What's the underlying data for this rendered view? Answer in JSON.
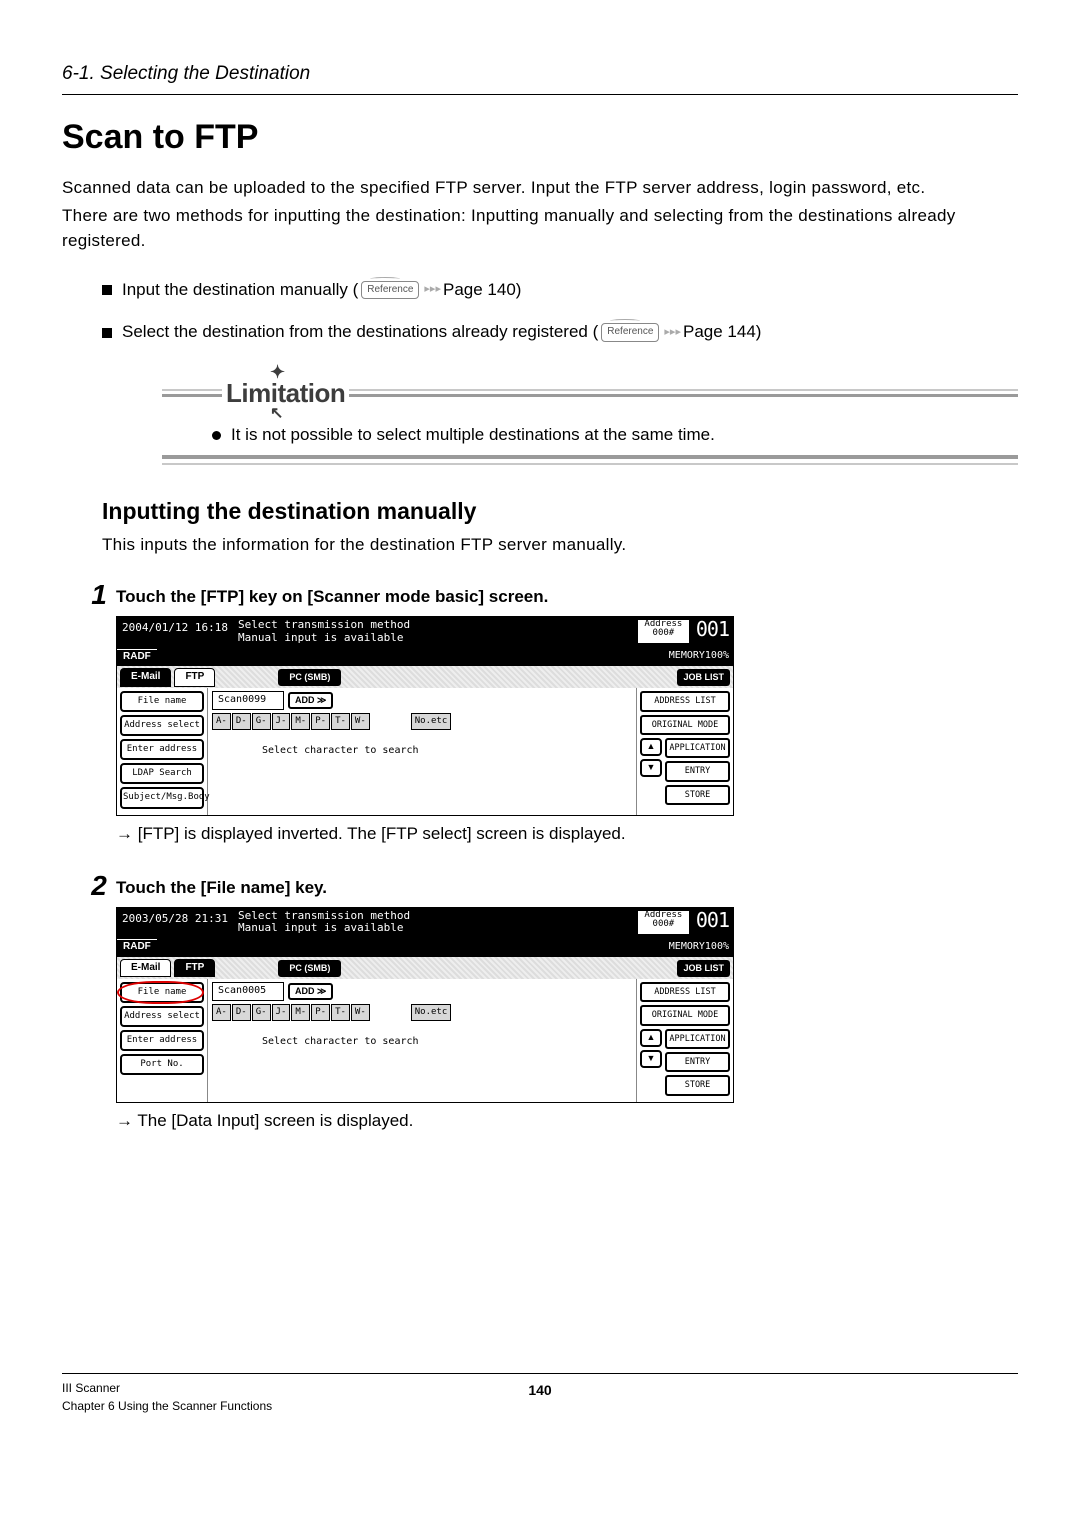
{
  "breadcrumb": "6-1. Selecting the Destination",
  "h1": "Scan to FTP",
  "intro_p1": "Scanned data can be uploaded to the specified FTP server. Input the FTP server address, login password, etc.",
  "intro_p2": "There are two methods for inputting the destination:  Inputting manually and selecting from the destinations already registered.",
  "bullets": {
    "b1_text": "Input the destination manually (",
    "b1_ref": "Reference",
    "b1_page": " Page 140)",
    "b2_text": "Select the destination from the destinations already registered (",
    "b2_ref": "Reference",
    "b2_page": " Page 144)"
  },
  "limitation": {
    "word": "Limitation",
    "text": "It is not possible to select multiple destinations at the same time."
  },
  "h2": "Inputting the destination manually",
  "h2_sub": "This inputs the information for the destination FTP server manually.",
  "steps": {
    "s1": {
      "num": "1",
      "title": "Touch the [FTP] key on [Scanner mode basic] screen.",
      "result": "→ [FTP] is displayed inverted.  The [FTP select] screen is displayed."
    },
    "s2": {
      "num": "2",
      "title": "Touch the [File name] key.",
      "result": "→ The [Data Input] screen is displayed."
    }
  },
  "panel1": {
    "datetime": "2004/01/12 16:18",
    "msg_l1": "Select transmission method",
    "msg_l2": "Manual input is available",
    "addr_label": "Address",
    "addr_num": "000#",
    "digits": "001",
    "radf": "RADF",
    "memory": "MEMORY100%",
    "tabs": {
      "email": "E-Mail",
      "ftp": "FTP",
      "pcsmb": "PC (SMB)",
      "joblist": "JOB LIST"
    },
    "left": [
      "File name",
      "Address select",
      "Enter address",
      "LDAP Search",
      "Subject/Msg.Body"
    ],
    "scan": "Scan0099",
    "add": "ADD ≫",
    "letters": [
      "A-",
      "D-",
      "G-",
      "J-",
      "M-",
      "P-",
      "T-",
      "W-"
    ],
    "noetc": "No.etc",
    "searchmsg": "Select character to search",
    "right": [
      "ADDRESS LIST",
      "ORIGINAL MODE",
      "APPLICATION",
      "ENTRY",
      "STORE"
    ]
  },
  "panel2": {
    "datetime": "2003/05/28 21:31",
    "msg_l1": "Select transmission method",
    "msg_l2": "Manual input is available",
    "addr_label": "Address",
    "addr_num": "000#",
    "digits": "001",
    "radf": "RADF",
    "memory": "MEMORY100%",
    "tabs": {
      "email": "E-Mail",
      "ftp": "FTP",
      "pcsmb": "PC (SMB)",
      "joblist": "JOB LIST"
    },
    "left": [
      "File name",
      "Address select",
      "Enter address",
      "Port No."
    ],
    "scan": "Scan0005",
    "add": "ADD ≫",
    "letters": [
      "A-",
      "D-",
      "G-",
      "J-",
      "M-",
      "P-",
      "T-",
      "W-"
    ],
    "noetc": "No.etc",
    "searchmsg": "Select character to search",
    "right": [
      "ADDRESS LIST",
      "ORIGINAL MODE",
      "APPLICATION",
      "ENTRY",
      "STORE"
    ]
  },
  "footer": {
    "line1": "III Scanner",
    "line2": "Chapter 6 Using the Scanner Functions",
    "page": "140"
  }
}
